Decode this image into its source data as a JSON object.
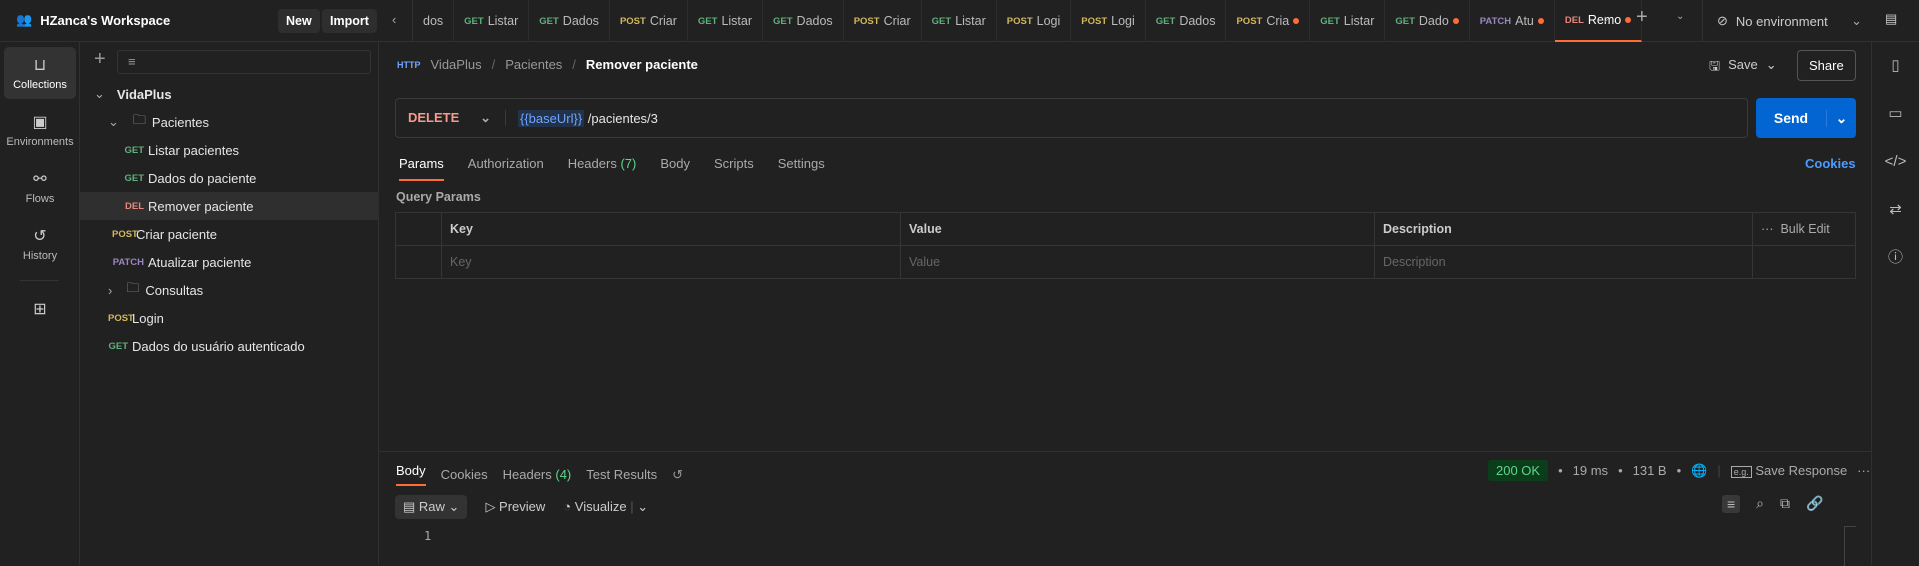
{
  "workspace": {
    "name": "HZanca's Workspace",
    "new_label": "New",
    "import_label": "Import"
  },
  "tabs": [
    {
      "method": "",
      "label": "dos",
      "dirty": false
    },
    {
      "method": "GET",
      "label": "Listar",
      "dirty": false
    },
    {
      "method": "GET",
      "label": "Dados",
      "dirty": false
    },
    {
      "method": "POST",
      "label": "Criar",
      "dirty": false
    },
    {
      "method": "GET",
      "label": "Listar",
      "dirty": false
    },
    {
      "method": "GET",
      "label": "Dados",
      "dirty": false
    },
    {
      "method": "POST",
      "label": "Criar",
      "dirty": false
    },
    {
      "method": "GET",
      "label": "Listar",
      "dirty": false
    },
    {
      "method": "POST",
      "label": "Logi",
      "dirty": false
    },
    {
      "method": "POST",
      "label": "Logi",
      "dirty": false
    },
    {
      "method": "GET",
      "label": "Dados",
      "dirty": false
    },
    {
      "method": "POST",
      "label": "Cria",
      "dirty": true
    },
    {
      "method": "GET",
      "label": "Listar",
      "dirty": false
    },
    {
      "method": "GET",
      "label": "Dado",
      "dirty": true
    },
    {
      "method": "PATCH",
      "label": "Atu",
      "dirty": true
    },
    {
      "method": "DEL",
      "label": "Remo",
      "dirty": true,
      "active": true
    }
  ],
  "environment": "No environment",
  "rail": [
    {
      "label": "Collections",
      "icon": "collections-icon"
    },
    {
      "label": "Environments",
      "icon": "environments-icon"
    },
    {
      "label": "Flows",
      "icon": "flows-icon"
    },
    {
      "label": "History",
      "icon": "history-icon"
    }
  ],
  "tree": {
    "collection": "VidaPlus",
    "folder1": "Pacientes",
    "items1": [
      {
        "method": "GET",
        "label": "Listar pacientes"
      },
      {
        "method": "GET",
        "label": "Dados do paciente"
      },
      {
        "method": "DEL",
        "label": "Remover paciente"
      }
    ],
    "items1b": [
      {
        "method": "POST",
        "label": "Criar paciente"
      },
      {
        "method": "PATCH",
        "label": "Atualizar paciente"
      }
    ],
    "folder2": "Consultas",
    "items2": [
      {
        "method": "POST",
        "label": "Login"
      },
      {
        "method": "GET",
        "label": "Dados do usuário autenticado"
      }
    ]
  },
  "breadcrumb": [
    "VidaPlus",
    "Pacientes",
    "Remover paciente"
  ],
  "save_label": "Save",
  "share_label": "Share",
  "request": {
    "method": "DELETE",
    "url_var": "{{baseUrl}}",
    "url_path": "/pacientes/3",
    "send_label": "Send"
  },
  "req_tabs": [
    "Params",
    "Authorization",
    "Headers",
    "(7)",
    "Body",
    "Scripts",
    "Settings"
  ],
  "cookies_label": "Cookies",
  "query_params": {
    "title": "Query Params",
    "headers": [
      "Key",
      "Value",
      "Description"
    ],
    "bulk_edit": "Bulk Edit",
    "placeholders": [
      "Key",
      "Value",
      "Description"
    ]
  },
  "response": {
    "tabs": [
      "Body",
      "Cookies",
      "Headers",
      "(4)",
      "Test Results"
    ],
    "status": "200 OK",
    "time": "19 ms",
    "size": "131 B",
    "save_response": "Save Response",
    "format": "Raw",
    "preview": "Preview",
    "visualize": "Visualize",
    "line": "1"
  },
  "colors": {
    "accent": "#ff6c37",
    "send": "#0265d2",
    "status_bg": "#0b3d1a",
    "status_fg": "#5ed68b"
  }
}
